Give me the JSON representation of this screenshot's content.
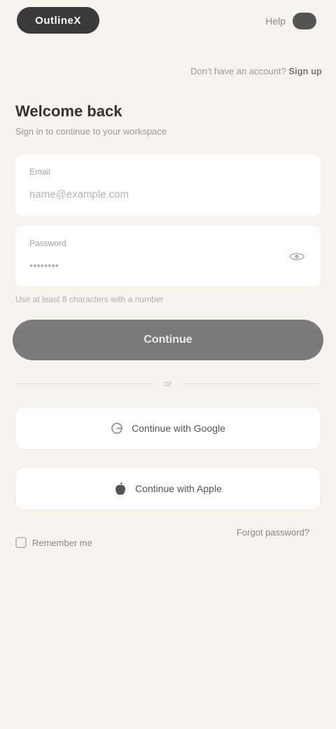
{
  "header": {
    "logo": "OutlineX",
    "link": "Help"
  },
  "topbar": {
    "prefix": "Don’t have an account?",
    "action": "Sign up"
  },
  "form": {
    "title": "Welcome back",
    "subtitle": "Sign in to continue to your workspace",
    "email": {
      "label": "Email",
      "placeholder": "name@example.com"
    },
    "password": {
      "label": "Password",
      "placeholder": "••••••••"
    },
    "hint": "Use at least 8 characters with a number",
    "submit_label": "Continue"
  },
  "divider": {
    "text": "or"
  },
  "social": {
    "google_label": "Continue with Google",
    "apple_label": "Continue with Apple"
  },
  "footer": {
    "remember_label": "Remember me",
    "forgot_label": "Forgot password?"
  },
  "colors": {
    "background": "#f7f4ef",
    "button": "#7a7a7a",
    "card": "#ffffff"
  }
}
